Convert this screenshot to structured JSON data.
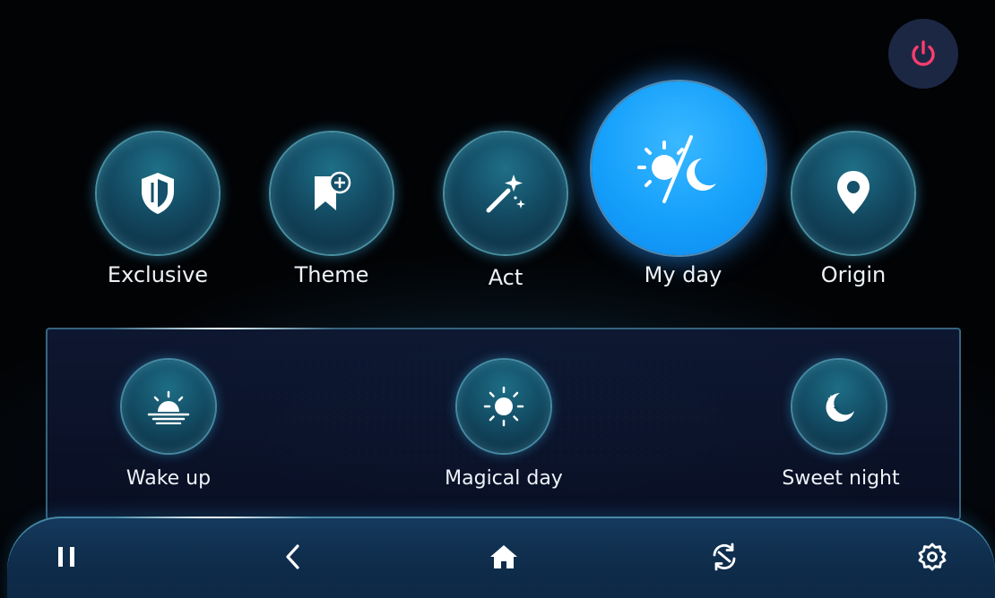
{
  "modes": [
    {
      "label": "Exclusive",
      "icon": "shield-icon"
    },
    {
      "label": "Theme",
      "icon": "bookmark-add-icon"
    },
    {
      "label": "Act",
      "icon": "magic-wand-icon"
    },
    {
      "label": "My day",
      "icon": "day-night-icon",
      "active": true
    },
    {
      "label": "Origin",
      "icon": "location-pin-icon"
    }
  ],
  "sub_modes": [
    {
      "label": "Wake up",
      "icon": "sunrise-icon"
    },
    {
      "label": "Magical day",
      "icon": "sun-icon"
    },
    {
      "label": "Sweet night",
      "icon": "moon-stars-icon"
    }
  ],
  "bottom_bar": {
    "buttons": [
      "pause-icon",
      "back-icon",
      "home-icon",
      "sync-icon",
      "settings-icon"
    ]
  },
  "colors": {
    "accent": "#15a0fb",
    "power": "#ff3d6e",
    "glow": "#78dcf0"
  }
}
